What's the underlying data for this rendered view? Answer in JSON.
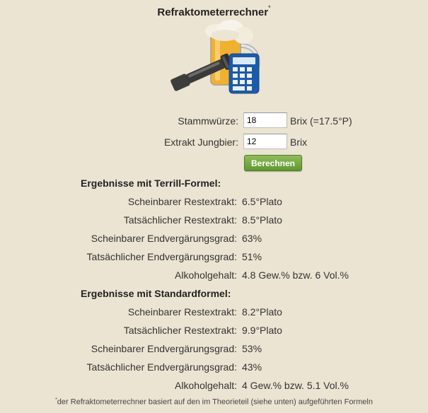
{
  "title": "Refraktometerrechner",
  "title_marker": "*",
  "form": {
    "stammwuerze_label": "Stammwürze:",
    "stammwuerze_value": "18",
    "stammwuerze_unit": "Brix (=17.5°P)",
    "extrakt_label": "Extrakt Jungbier:",
    "extrakt_value": "12",
    "extrakt_unit": "Brix",
    "button_label": "Berechnen"
  },
  "terrill": {
    "heading": "Ergebnisse mit Terrill-Formel:",
    "rows": [
      {
        "label": "Scheinbarer Restextrakt:",
        "value": "6.5°Plato"
      },
      {
        "label": "Tatsächlicher Restextrakt:",
        "value": "8.5°Plato"
      },
      {
        "label": "Scheinbarer Endvergärungsgrad:",
        "value": "63%"
      },
      {
        "label": "Tatsächlicher Endvergärungsgrad:",
        "value": "51%"
      },
      {
        "label": "Alkoholgehalt:",
        "value": "4.8 Gew.% bzw. 6 Vol.%"
      }
    ]
  },
  "standard": {
    "heading": "Ergebnisse mit Standardformel:",
    "rows": [
      {
        "label": "Scheinbarer Restextrakt:",
        "value": "8.2°Plato"
      },
      {
        "label": "Tatsächlicher Restextrakt:",
        "value": "9.9°Plato"
      },
      {
        "label": "Scheinbarer Endvergärungsgrad:",
        "value": "53%"
      },
      {
        "label": "Tatsächlicher Endvergärungsgrad:",
        "value": "43%"
      },
      {
        "label": "Alkoholgehalt:",
        "value": "4 Gew.% bzw. 5.1 Vol.%"
      }
    ]
  },
  "footnote": {
    "marker": "*",
    "text": "der Refraktometerrechner basiert auf den im Theorieteil (siehe unten) aufgeführten Formeln"
  },
  "colors": {
    "background": "#ebe4d2",
    "button": "#6ea33a"
  },
  "icons": [
    "refractometer-icon",
    "beer-mug-icon",
    "calculator-icon"
  ]
}
